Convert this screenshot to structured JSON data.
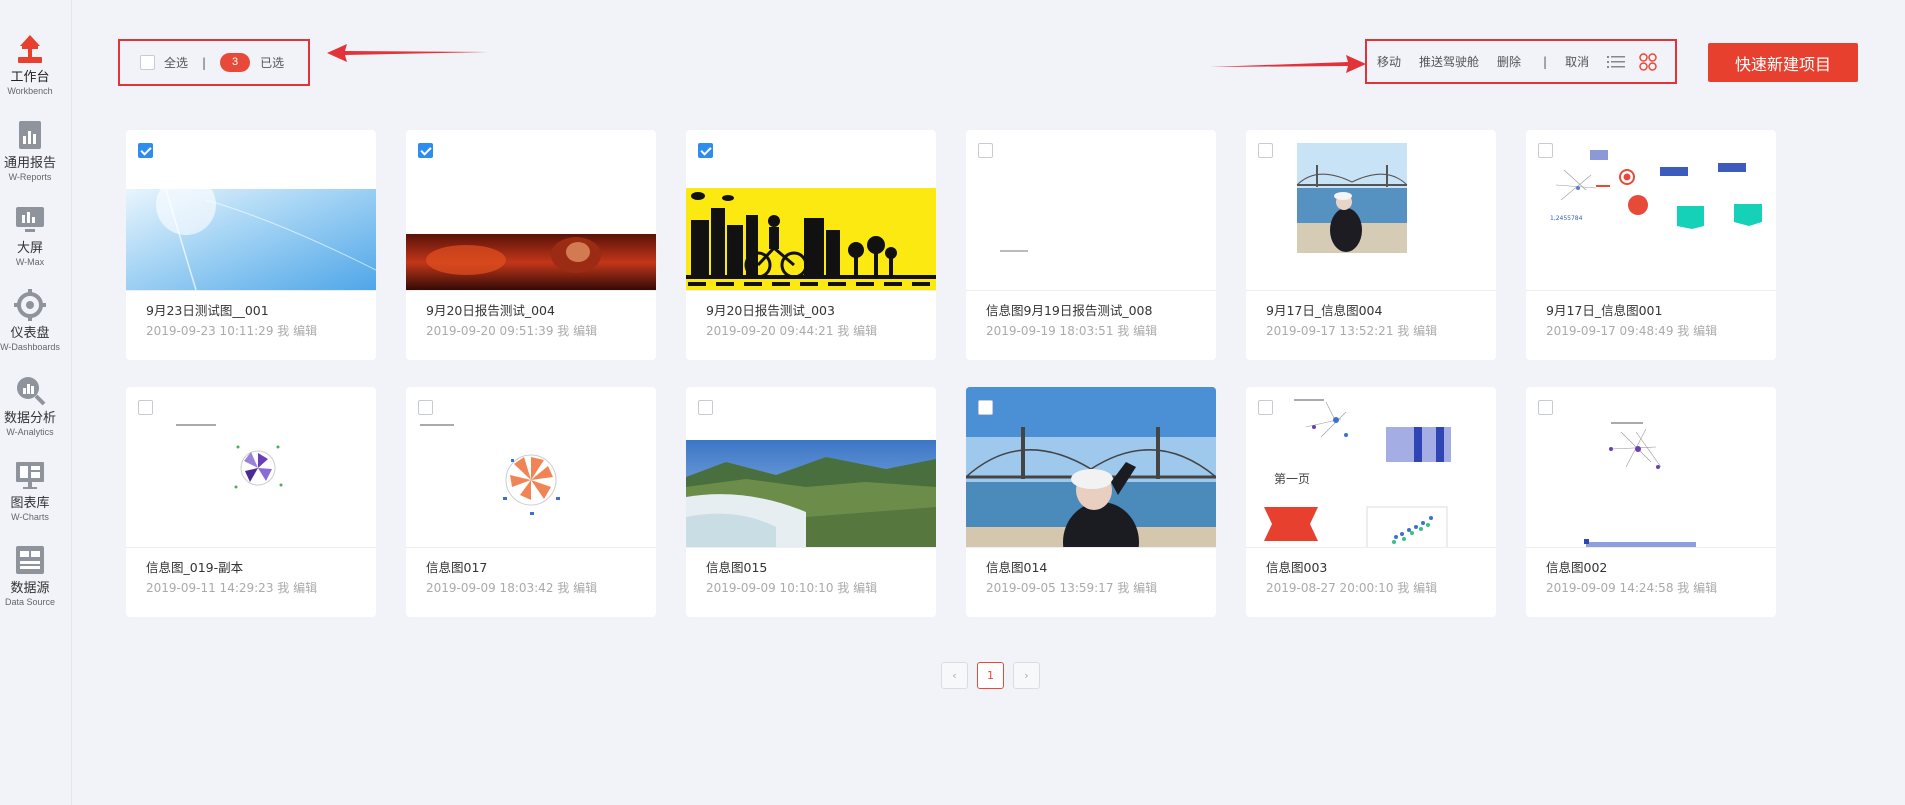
{
  "sidebar": {
    "items": [
      {
        "zh": "工作台",
        "en": "Workbench",
        "icon": "workbench-icon",
        "active": true
      },
      {
        "zh": "通用报告",
        "en": "W-Reports",
        "icon": "report-icon"
      },
      {
        "zh": "大屏",
        "en": "W-Max",
        "icon": "bigscreen-icon"
      },
      {
        "zh": "仪表盘",
        "en": "W-Dashboards",
        "icon": "dashboard-icon"
      },
      {
        "zh": "数据分析",
        "en": "W-Analytics",
        "icon": "analytics-icon"
      },
      {
        "zh": "图表库",
        "en": "W-Charts",
        "icon": "charts-icon"
      },
      {
        "zh": "数据源",
        "en": "Data Source",
        "icon": "datasource-icon"
      }
    ]
  },
  "toolbar": {
    "select_all": "全选",
    "separator": "|",
    "selected_count": "3",
    "selected_label": "已选",
    "move": "移动",
    "push": "推送驾驶舱",
    "delete": "删除",
    "cancel": "取消",
    "new_project": "快速新建项目"
  },
  "cards": [
    {
      "title": "9月23日测试图__001",
      "meta": "2019-09-23 10:11:29 我 编辑",
      "checked": true
    },
    {
      "title": "9月20日报告测试_004",
      "meta": "2019-09-20 09:51:39 我 编辑",
      "checked": true
    },
    {
      "title": "9月20日报告测试_003",
      "meta": "2019-09-20 09:44:21 我 编辑",
      "checked": true
    },
    {
      "title": "信息图9月19日报告测试_008",
      "meta": "2019-09-19 18:03:51 我 编辑",
      "checked": false
    },
    {
      "title": "9月17日_信息图004",
      "meta": "2019-09-17 13:52:21 我 编辑",
      "checked": false
    },
    {
      "title": "9月17日_信息图001",
      "meta": "2019-09-17 09:48:49 我 编辑",
      "checked": false
    },
    {
      "title": "信息图_019-副本",
      "meta": "2019-09-11 14:29:23 我 编辑",
      "checked": false
    },
    {
      "title": "信息图017",
      "meta": "2019-09-09 18:03:42 我 编辑",
      "checked": false
    },
    {
      "title": "信息图015",
      "meta": "2019-09-09 10:10:10 我 编辑",
      "checked": false
    },
    {
      "title": "信息图014",
      "meta": "2019-09-05 13:59:17 我 编辑",
      "checked": false
    },
    {
      "title": "信息图003",
      "meta": "2019-08-27 20:00:10 我 编辑",
      "checked": false
    },
    {
      "title": "信息图002",
      "meta": "2019-09-09 14:24:58 我 编辑",
      "checked": false
    }
  ],
  "thumb_text": {
    "card11_page": "第一页",
    "card6_number": "1,2455784"
  },
  "pagination": {
    "prev": "‹",
    "current": "1",
    "next": "›"
  },
  "colors": {
    "accent": "#e8402f",
    "checkbox": "#2d8cf0",
    "annotation": "#e2333a"
  }
}
